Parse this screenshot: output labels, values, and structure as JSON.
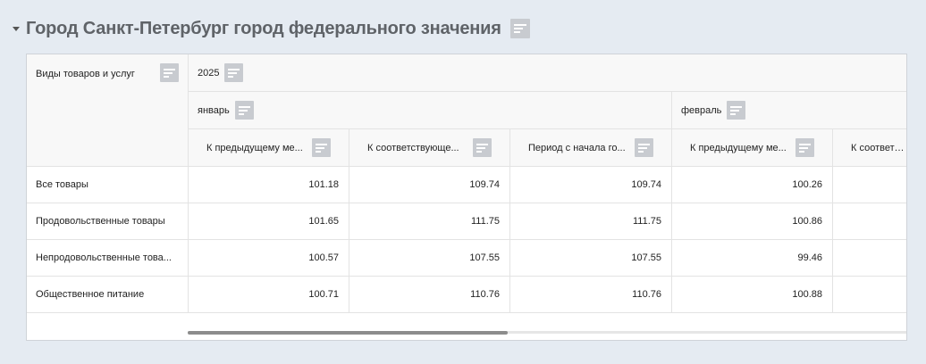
{
  "section": {
    "title": "Город Санкт-Петербург город федерального значения"
  },
  "table": {
    "row_header_label": "Виды товаров и услуг",
    "year": "2025",
    "months": [
      "январь",
      "февраль"
    ],
    "columns": [
      "К предыдущему ме...",
      "К соответствующе...",
      "Период с начала го...",
      "К предыдущему ме...",
      "К соответств"
    ],
    "rows": [
      {
        "label": "Все товары",
        "values": [
          "101.18",
          "109.74",
          "109.74",
          "100.26"
        ]
      },
      {
        "label": "Продовольственные товары",
        "values": [
          "101.65",
          "111.75",
          "111.75",
          "100.86"
        ]
      },
      {
        "label": "Непродовольственные това...",
        "values": [
          "100.57",
          "107.55",
          "107.55",
          "99.46"
        ]
      },
      {
        "label": "Общественное питание",
        "values": [
          "100.71",
          "110.76",
          "110.76",
          "100.88"
        ]
      }
    ]
  }
}
